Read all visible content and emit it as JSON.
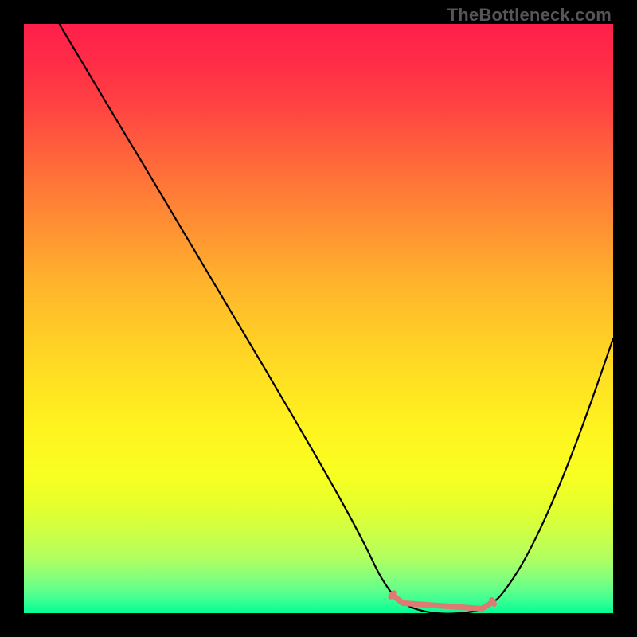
{
  "watermark": "TheBottleneck.com",
  "chart_data": {
    "type": "line",
    "title": "",
    "xlabel": "",
    "ylabel": "",
    "xlim": [
      0,
      100
    ],
    "ylim": [
      0,
      100
    ],
    "grid": false,
    "legend": false,
    "gradient_stops": [
      {
        "offset": 0.0,
        "color": "#ff1f4b"
      },
      {
        "offset": 0.06,
        "color": "#ff2b47"
      },
      {
        "offset": 0.14,
        "color": "#ff4342"
      },
      {
        "offset": 0.24,
        "color": "#ff6a3a"
      },
      {
        "offset": 0.34,
        "color": "#ff8f33"
      },
      {
        "offset": 0.43,
        "color": "#ffb02d"
      },
      {
        "offset": 0.52,
        "color": "#ffcb27"
      },
      {
        "offset": 0.61,
        "color": "#ffe222"
      },
      {
        "offset": 0.69,
        "color": "#fff41f"
      },
      {
        "offset": 0.77,
        "color": "#f7ff22"
      },
      {
        "offset": 0.82,
        "color": "#e4ff2e"
      },
      {
        "offset": 0.865,
        "color": "#ccff46"
      },
      {
        "offset": 0.905,
        "color": "#b2ff60"
      },
      {
        "offset": 0.935,
        "color": "#8bff78"
      },
      {
        "offset": 0.955,
        "color": "#6cff86"
      },
      {
        "offset": 0.975,
        "color": "#43ff92"
      },
      {
        "offset": 0.992,
        "color": "#17fe95"
      },
      {
        "offset": 1.0,
        "color": "#00fe96"
      }
    ],
    "series": [
      {
        "name": "bottleneck-curve",
        "color": "#000000",
        "x": [
          6.0,
          10.0,
          15.0,
          20.0,
          25.0,
          30.0,
          35.0,
          40.0,
          45.0,
          50.0,
          55.0,
          58.0,
          60.5,
          63.0,
          66.0,
          70.0,
          74.0,
          77.5,
          79.5,
          81.0,
          84.0,
          87.0,
          90.0,
          93.0,
          96.0,
          99.0,
          100.0
        ],
        "values": [
          100.0,
          93.3,
          84.9,
          76.6,
          68.2,
          59.8,
          51.4,
          43.0,
          34.5,
          25.9,
          17.0,
          11.3,
          6.3,
          2.8,
          0.9,
          0.0,
          0.0,
          0.6,
          1.8,
          3.1,
          7.4,
          13.0,
          19.6,
          27.0,
          35.1,
          43.7,
          46.6
        ]
      },
      {
        "name": "sweet-spot-marker",
        "color": "#df7a72",
        "type": "segment",
        "endpoints": [
          {
            "x": 62.5,
            "y": 3.1
          },
          {
            "x": 64.3,
            "y": 1.7
          },
          {
            "x": 77.7,
            "y": 0.75
          },
          {
            "x": 79.6,
            "y": 1.9
          }
        ],
        "cap_radius_px": 5.2,
        "stroke_width_px": 7.2
      }
    ]
  }
}
